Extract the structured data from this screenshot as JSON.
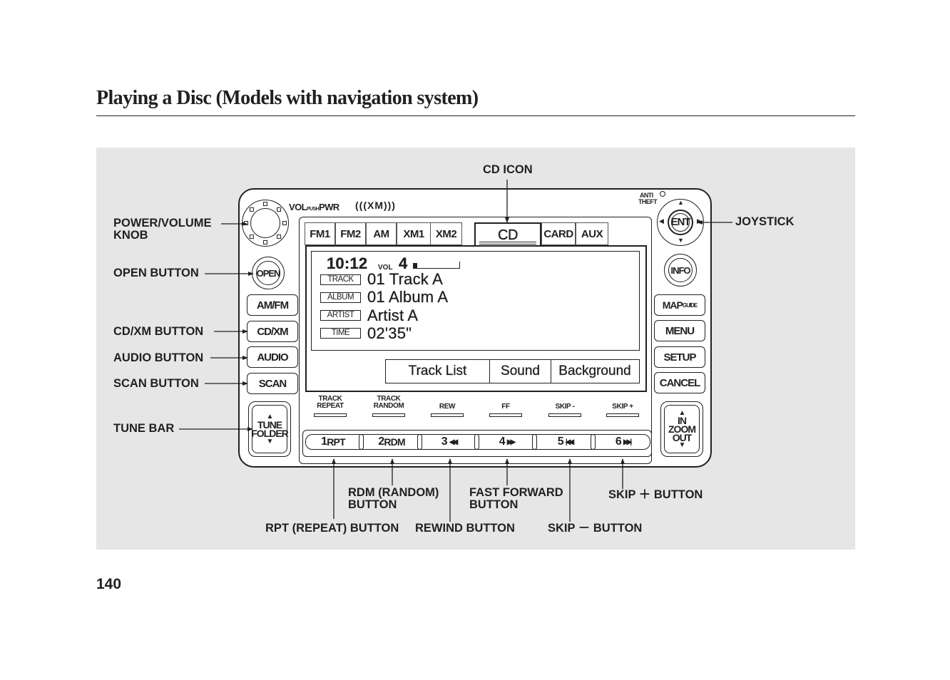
{
  "page": {
    "title": "Playing a Disc (Models with navigation system)",
    "page_number": "140"
  },
  "unit": {
    "vol_push_pwr": "VOLpushPWR",
    "xm_logo": "(((XM)))",
    "anti_theft": [
      "ANTI",
      "THEFT"
    ],
    "source_tabs": [
      {
        "label": "FM1",
        "active": false
      },
      {
        "label": "FM2",
        "active": false
      },
      {
        "label": "AM",
        "active": false
      },
      {
        "label": "XM1",
        "active": false
      },
      {
        "label": "XM2",
        "active": false
      },
      {
        "label": "CD",
        "active": true
      },
      {
        "label": "CARD",
        "active": false
      },
      {
        "label": "AUX",
        "active": false
      }
    ],
    "display": {
      "clock": "10:12",
      "vol_label": "VOL",
      "vol_value": "4",
      "volume_level_fraction": 0.06,
      "rows": [
        {
          "tag": "TRACK",
          "value": "01  Track  A"
        },
        {
          "tag": "ALBUM",
          "value": "01  Album  A"
        },
        {
          "tag": "ARTIST",
          "value": "Artist  A"
        },
        {
          "tag": "TIME",
          "value": "02'35\""
        }
      ],
      "softkeys": [
        "Track  List",
        "Sound",
        "Background"
      ]
    },
    "preset_labels": [
      [
        "TRACK",
        "REPEAT"
      ],
      [
        "TRACK",
        "RANDOM"
      ],
      [
        "REW"
      ],
      [
        "FF"
      ],
      [
        "SKIP -"
      ],
      [
        "SKIP +"
      ]
    ],
    "preset_buttons": [
      {
        "num": "1",
        "label": "RPT",
        "icon": ""
      },
      {
        "num": "2",
        "label": "RDM",
        "icon": ""
      },
      {
        "num": "3",
        "label": "",
        "icon": "◀◀"
      },
      {
        "num": "4",
        "label": "",
        "icon": "▶▶"
      },
      {
        "num": "5",
        "label": "",
        "icon": "|◀◀"
      },
      {
        "num": "6",
        "label": "",
        "icon": "▶▶|"
      }
    ],
    "left_buttons": {
      "open": "OPEN",
      "am_fm": "AM/FM",
      "cd_xm": "CD/XM",
      "audio": "AUDIO",
      "scan": "SCAN",
      "tune_folder": [
        "TUNE",
        "FOLDER"
      ]
    },
    "right_buttons": {
      "ent": "ENT",
      "info": "INFO",
      "map_guide": "MAPguide",
      "menu": "MENU",
      "setup": "SETUP",
      "cancel": "CANCEL",
      "zoom": [
        "IN",
        "ZOOM",
        "OUT"
      ]
    }
  },
  "callouts": {
    "cd_icon": "CD ICON",
    "power_volume_knob": [
      "POWER/VOLUME",
      "KNOB"
    ],
    "open_button": "OPEN BUTTON",
    "cd_xm_button": "CD/XM BUTTON",
    "audio_button": "AUDIO BUTTON",
    "scan_button": "SCAN BUTTON",
    "tune_bar": "TUNE BAR",
    "joystick": "JOYSTICK",
    "rdm_button": [
      "RDM (RANDOM)",
      "BUTTON"
    ],
    "fast_forward_button": [
      "FAST FORWARD",
      "BUTTON"
    ],
    "skip_plus_button": "SKIP ＋ BUTTON",
    "rpt_button": "RPT (REPEAT) BUTTON",
    "rewind_button": "REWIND BUTTON",
    "skip_minus_button": "SKIP － BUTTON"
  },
  "colors": {
    "ink": "#231f20",
    "panel": "#e6e6e6"
  }
}
